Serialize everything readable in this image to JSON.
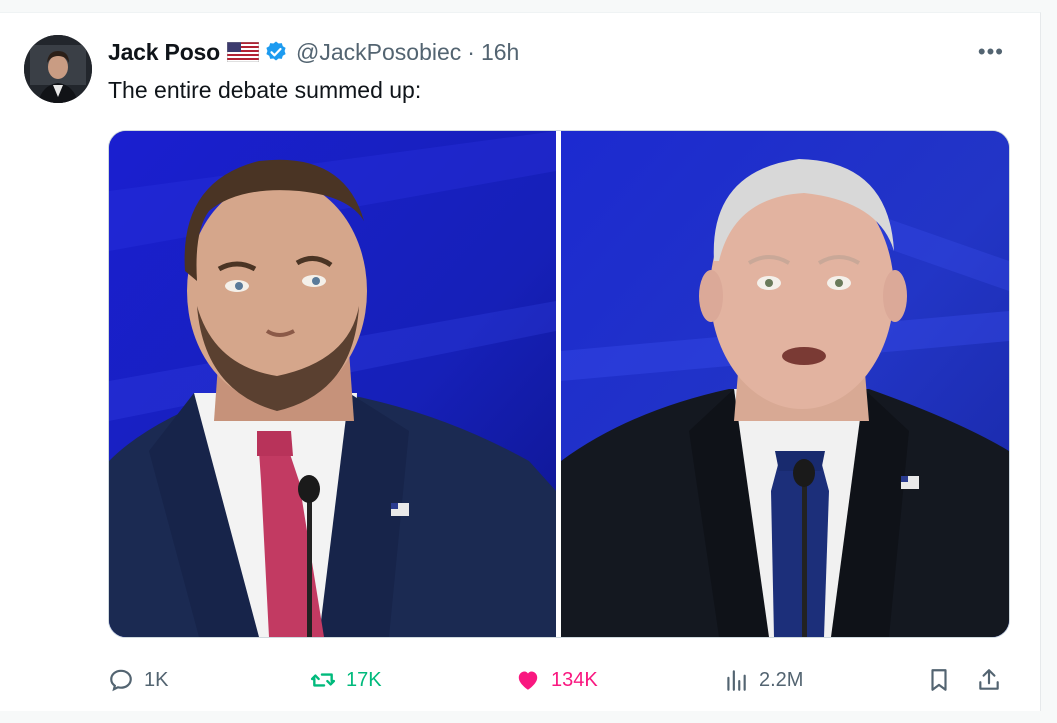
{
  "tweet": {
    "author_name": "Jack Poso",
    "author_flag": "US",
    "handle": "@JackPosobiec",
    "separator": "·",
    "time": "16h",
    "more_label": "•••",
    "text": "The entire debate summed up:"
  },
  "actions": {
    "replies": "1K",
    "reposts": "17K",
    "likes": "134K",
    "views": "2.2M"
  },
  "colors": {
    "verified": "#1d9bf0",
    "repost": "#00ba7c",
    "like": "#f91880",
    "muted": "#536471",
    "studio_blue": "#1a22c4"
  },
  "icons": [
    "reply-icon",
    "retweet-icon",
    "heart-icon",
    "views-icon",
    "bookmark-icon",
    "share-icon",
    "verified-icon",
    "us-flag-icon",
    "more-icon"
  ]
}
